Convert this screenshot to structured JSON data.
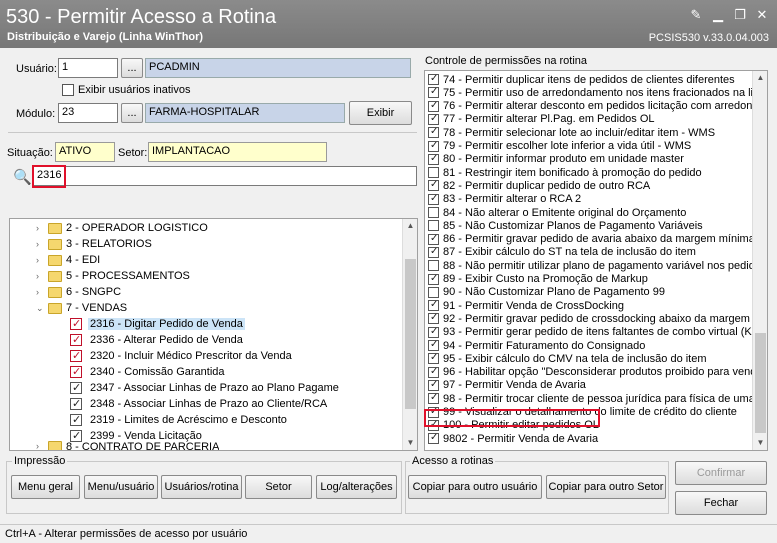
{
  "window": {
    "title": "530 - Permitir Acesso a Rotina",
    "subtitle": "Distribuição e Varejo (Linha WinThor)",
    "code": "PCSIS530  v.33.0.04.003"
  },
  "form": {
    "usuario_label": "Usuário:",
    "usuario_id": "1",
    "usuario_name": "PCADMIN",
    "exibir_inativos": "Exibir usuários inativos",
    "modulo_label": "Módulo:",
    "modulo_id": "23",
    "modulo_name": "FARMA-HOSPITALAR",
    "exibir_button": "Exibir",
    "lookup_button": "...",
    "situacao_label": "Situação:",
    "situacao_value": "ATIVO",
    "setor_label": "Setor:",
    "setor_value": "IMPLANTACAO",
    "search_value": "2316"
  },
  "tree": [
    {
      "label": "2 - OPERADOR LOGISTICO"
    },
    {
      "label": "3 - RELATORIOS"
    },
    {
      "label": "4 - EDI"
    },
    {
      "label": "5 - PROCESSAMENTOS"
    },
    {
      "label": "6 - SNGPC"
    },
    {
      "label": "7 - VENDAS"
    },
    {
      "label": "2316 - Digitar Pedido de Venda"
    },
    {
      "label": "2336 - Alterar Pedido de Venda"
    },
    {
      "label": "2320 - Incluir Médico Prescritor da Venda"
    },
    {
      "label": "2340 - Comissão Garantida"
    },
    {
      "label": "2347 - Associar Linhas de Prazo ao Plano Pagame"
    },
    {
      "label": "2348 - Associar Linhas de Prazo ao Cliente/RCA"
    },
    {
      "label": "2319 - Limites de Acréscimo e Desconto"
    },
    {
      "label": "2399 - Venda Licitação"
    },
    {
      "label": "8 - CONTRATO DE PARCERIA"
    }
  ],
  "permissions": {
    "title": "Controle de permissões na rotina",
    "items": [
      {
        "label": "74 - Permitir duplicar itens de pedidos de clientes diferentes",
        "checked": true
      },
      {
        "label": "75 - Permitir uso de arredondamento nos itens fracionados na lic",
        "checked": true
      },
      {
        "label": "76 - Permitir alterar desconto em pedidos licitação com arredonda",
        "checked": true
      },
      {
        "label": "77 - Permitir alterar Pl.Pag. em Pedidos OL",
        "checked": true
      },
      {
        "label": "78 - Permitir selecionar lote ao incluir/editar item - WMS",
        "checked": true
      },
      {
        "label": "79 - Permitir escolher lote inferior a vida útil - WMS",
        "checked": true
      },
      {
        "label": "80 - Permitir informar produto em unidade master",
        "checked": true
      },
      {
        "label": "81 - Restringir item bonificado à promoção do pedido",
        "checked": false
      },
      {
        "label": "82 - Permitir duplicar pedido de outro RCA",
        "checked": true
      },
      {
        "label": "83 - Permitir alterar o RCA 2",
        "checked": true
      },
      {
        "label": "84 - Não alterar o Emitente original do Orçamento",
        "checked": false
      },
      {
        "label": "85 - Não Customizar Planos de Pagamento Variáveis",
        "checked": false
      },
      {
        "label": "86 - Permitir gravar pedido de avaria abaixo da margem mínima",
        "checked": true
      },
      {
        "label": "87 - Exibir cálculo do ST na tela de inclusão do item",
        "checked": true
      },
      {
        "label": "88 - Não permitir utilizar plano de pagamento variável nos pedido",
        "checked": false
      },
      {
        "label": "89 - Exibir Custo na Promoção de Markup",
        "checked": true
      },
      {
        "label": "90 - Não Customizar Plano de Pagamento 99",
        "checked": false
      },
      {
        "label": "91 - Permitir Venda de CrossDocking",
        "checked": true
      },
      {
        "label": "92 - Permitir gravar pedido de crossdocking abaixo da margem m",
        "checked": true
      },
      {
        "label": "93 - Permitir gerar pedido de itens faltantes de combo virtual (K",
        "checked": true
      },
      {
        "label": "94 - Permitir Faturamento do Consignado",
        "checked": true
      },
      {
        "label": "95 - Exibir cálculo do CMV na tela de inclusão do item",
        "checked": true
      },
      {
        "label": "96 - Habilitar opção \"Desconsiderar produtos proibido para venda",
        "checked": true
      },
      {
        "label": "97 - Permitir Venda de Avaria",
        "checked": true
      },
      {
        "label": "98 - Permitir trocar cliente de pessoa jurídica para física de uma v",
        "checked": true
      },
      {
        "label": "99 - Visualizar o detalhamento do limite de crédito do cliente",
        "checked": true
      },
      {
        "label": "100 - Permitir editar pedidos OL",
        "checked": true
      },
      {
        "label": "9802 - Permitir Venda de Avaria",
        "checked": true
      }
    ]
  },
  "impressao": {
    "title": "Impressão",
    "buttons": [
      "Menu geral",
      "Menu/usuário",
      "Usuários/rotina",
      "Setor",
      "Log/alterações"
    ]
  },
  "acesso": {
    "title": "Acesso a rotinas",
    "copiar_usuario": "Copiar para outro usuário",
    "copiar_setor": "Copiar para outro Setor"
  },
  "actions": {
    "confirmar": "Confirmar",
    "fechar": "Fechar"
  },
  "status": "Ctrl+A - Alterar permissões de acesso por usuário"
}
